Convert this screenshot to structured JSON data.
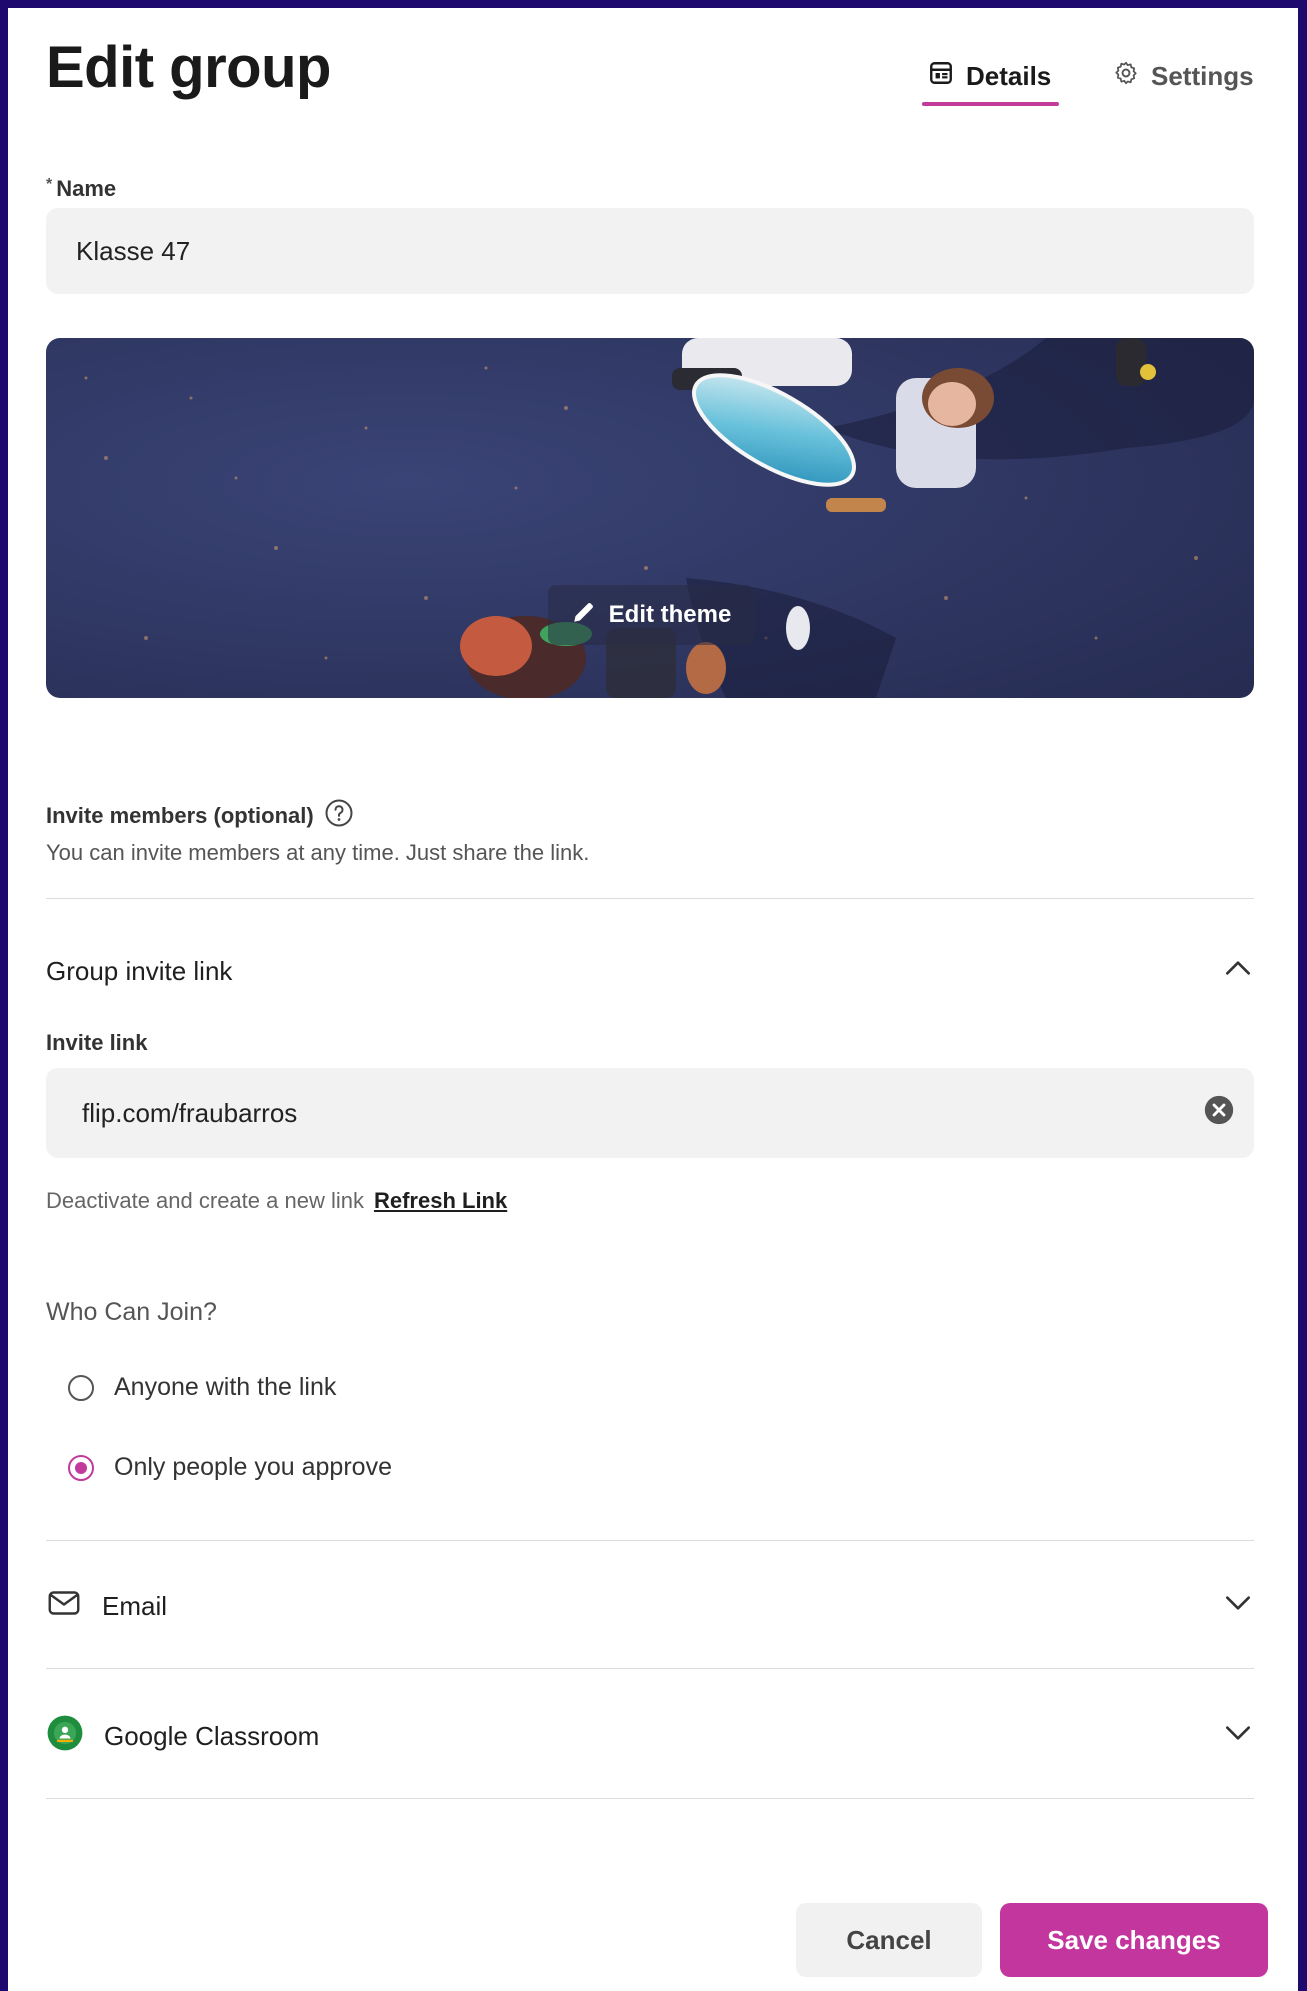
{
  "header": {
    "title": "Edit group",
    "tabs": [
      {
        "label": "Details",
        "icon": "details-icon",
        "active": true
      },
      {
        "label": "Settings",
        "icon": "gear-icon",
        "active": false
      }
    ]
  },
  "name_field": {
    "required_mark": "*",
    "label": "Name",
    "value": "Klasse 47"
  },
  "theme": {
    "edit_label": "Edit theme"
  },
  "invite": {
    "title": "Invite members (optional)",
    "subtitle": "You can invite members at any time. Just share the link."
  },
  "group_invite_link": {
    "title": "Group invite link",
    "link_label": "Invite link",
    "link_value": "flip.com/fraubarros",
    "refresh_text": "Deactivate and create a new link",
    "refresh_link": "Refresh Link"
  },
  "who_can_join": {
    "title": "Who Can Join?",
    "options": [
      {
        "label": "Anyone with the link",
        "selected": false
      },
      {
        "label": "Only people you approve",
        "selected": true
      }
    ]
  },
  "sections": {
    "email": "Email",
    "google_classroom": "Google Classroom"
  },
  "footer": {
    "cancel": "Cancel",
    "save": "Save changes"
  },
  "colors": {
    "accent": "#c2369d",
    "frame": "#1e0a6e",
    "google_classroom_green": "#1e8e3e"
  }
}
